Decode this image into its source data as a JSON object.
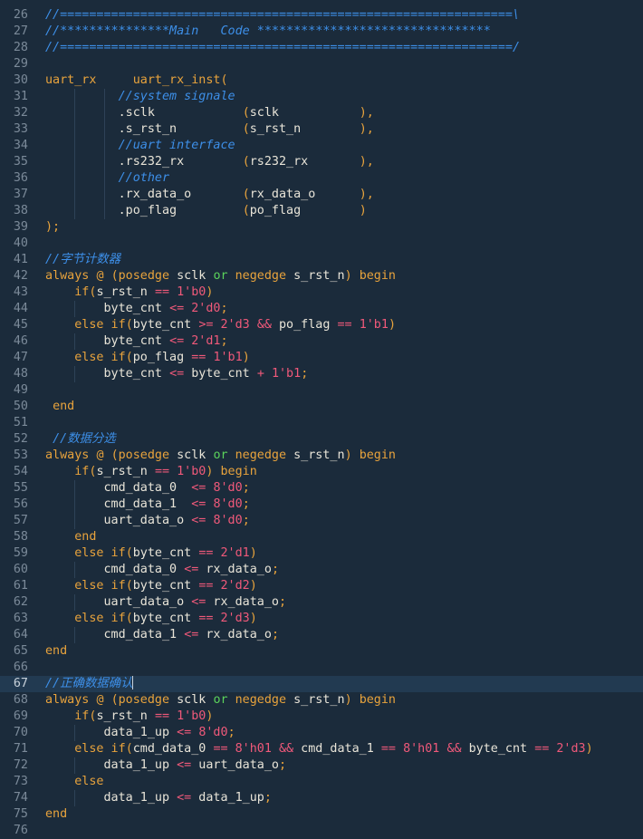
{
  "editor": {
    "active_line": 67,
    "lines": [
      {
        "n": 26,
        "tokens": [
          [
            "comment",
            "//==============================================================\\"
          ]
        ]
      },
      {
        "n": 27,
        "tokens": [
          [
            "comment",
            "//***************Main   Code ********************************"
          ]
        ]
      },
      {
        "n": 28,
        "tokens": [
          [
            "comment",
            "//==============================================================/"
          ]
        ]
      },
      {
        "n": 29,
        "tokens": []
      },
      {
        "n": 30,
        "tokens": [
          [
            "kw",
            "uart_rx"
          ],
          [
            "plain",
            "     "
          ],
          [
            "kw",
            "uart_rx_inst("
          ]
        ]
      },
      {
        "n": 31,
        "tokens": [
          [
            "plain",
            "          "
          ],
          [
            "comment",
            "//system signale"
          ]
        ]
      },
      {
        "n": 32,
        "tokens": [
          [
            "plain",
            "          "
          ],
          [
            "plain",
            ".sclk"
          ],
          [
            "plain",
            "            "
          ],
          [
            "punct",
            "("
          ],
          [
            "plain",
            "sclk"
          ],
          [
            "plain",
            "           "
          ],
          [
            "punct",
            "),"
          ]
        ]
      },
      {
        "n": 33,
        "tokens": [
          [
            "plain",
            "          "
          ],
          [
            "plain",
            ".s_rst_n"
          ],
          [
            "plain",
            "         "
          ],
          [
            "punct",
            "("
          ],
          [
            "plain",
            "s_rst_n"
          ],
          [
            "plain",
            "        "
          ],
          [
            "punct",
            "),"
          ]
        ]
      },
      {
        "n": 34,
        "tokens": [
          [
            "plain",
            "          "
          ],
          [
            "comment",
            "//uart interface"
          ]
        ]
      },
      {
        "n": 35,
        "tokens": [
          [
            "plain",
            "          "
          ],
          [
            "plain",
            ".rs232_rx"
          ],
          [
            "plain",
            "        "
          ],
          [
            "punct",
            "("
          ],
          [
            "plain",
            "rs232_rx"
          ],
          [
            "plain",
            "       "
          ],
          [
            "punct",
            "),"
          ]
        ]
      },
      {
        "n": 36,
        "tokens": [
          [
            "plain",
            "          "
          ],
          [
            "comment",
            "//other"
          ]
        ]
      },
      {
        "n": 37,
        "tokens": [
          [
            "plain",
            "          "
          ],
          [
            "plain",
            ".rx_data_o"
          ],
          [
            "plain",
            "       "
          ],
          [
            "punct",
            "("
          ],
          [
            "plain",
            "rx_data_o"
          ],
          [
            "plain",
            "      "
          ],
          [
            "punct",
            "),"
          ]
        ]
      },
      {
        "n": 38,
        "tokens": [
          [
            "plain",
            "          "
          ],
          [
            "plain",
            ".po_flag"
          ],
          [
            "plain",
            "         "
          ],
          [
            "punct",
            "("
          ],
          [
            "plain",
            "po_flag"
          ],
          [
            "plain",
            "        "
          ],
          [
            "punct",
            ")"
          ]
        ]
      },
      {
        "n": 39,
        "tokens": [
          [
            "punct",
            ");"
          ]
        ]
      },
      {
        "n": 40,
        "tokens": []
      },
      {
        "n": 41,
        "tokens": [
          [
            "comment",
            "//"
          ],
          [
            "cjk",
            "字节计数器"
          ]
        ]
      },
      {
        "n": 42,
        "tokens": [
          [
            "kw",
            "always"
          ],
          [
            "plain",
            " "
          ],
          [
            "kw",
            "@"
          ],
          [
            "plain",
            " "
          ],
          [
            "punct",
            "("
          ],
          [
            "kw",
            "posedge"
          ],
          [
            "plain",
            " sclk "
          ],
          [
            "green",
            "or"
          ],
          [
            "plain",
            " "
          ],
          [
            "kw",
            "negedge"
          ],
          [
            "plain",
            " s_rst_n"
          ],
          [
            "punct",
            ")"
          ],
          [
            "plain",
            " "
          ],
          [
            "kw",
            "begin"
          ]
        ]
      },
      {
        "n": 43,
        "tokens": [
          [
            "plain",
            "    "
          ],
          [
            "kw",
            "if"
          ],
          [
            "punct",
            "("
          ],
          [
            "plain",
            "s_rst_n "
          ],
          [
            "op",
            "=="
          ],
          [
            "plain",
            " "
          ],
          [
            "num",
            "1'b0"
          ],
          [
            "punct",
            ")"
          ]
        ]
      },
      {
        "n": 44,
        "tokens": [
          [
            "plain",
            "        byte_cnt "
          ],
          [
            "op",
            "<="
          ],
          [
            "plain",
            " "
          ],
          [
            "num",
            "2'd0"
          ],
          [
            "punct",
            ";"
          ]
        ]
      },
      {
        "n": 45,
        "tokens": [
          [
            "plain",
            "    "
          ],
          [
            "kw",
            "else if"
          ],
          [
            "punct",
            "("
          ],
          [
            "plain",
            "byte_cnt "
          ],
          [
            "op",
            ">="
          ],
          [
            "plain",
            " "
          ],
          [
            "num",
            "2'd3"
          ],
          [
            "plain",
            " "
          ],
          [
            "op",
            "&&"
          ],
          [
            "plain",
            " po_flag "
          ],
          [
            "op",
            "=="
          ],
          [
            "plain",
            " "
          ],
          [
            "num",
            "1'b1"
          ],
          [
            "punct",
            ")"
          ]
        ]
      },
      {
        "n": 46,
        "tokens": [
          [
            "plain",
            "        byte_cnt "
          ],
          [
            "op",
            "<="
          ],
          [
            "plain",
            " "
          ],
          [
            "num",
            "2'd1"
          ],
          [
            "punct",
            ";"
          ]
        ]
      },
      {
        "n": 47,
        "tokens": [
          [
            "plain",
            "    "
          ],
          [
            "kw",
            "else if"
          ],
          [
            "punct",
            "("
          ],
          [
            "plain",
            "po_flag "
          ],
          [
            "op",
            "=="
          ],
          [
            "plain",
            " "
          ],
          [
            "num",
            "1'b1"
          ],
          [
            "punct",
            ")"
          ]
        ]
      },
      {
        "n": 48,
        "tokens": [
          [
            "plain",
            "        byte_cnt "
          ],
          [
            "op",
            "<="
          ],
          [
            "plain",
            " byte_cnt "
          ],
          [
            "op",
            "+"
          ],
          [
            "plain",
            " "
          ],
          [
            "num",
            "1'b1"
          ],
          [
            "punct",
            ";"
          ]
        ]
      },
      {
        "n": 49,
        "tokens": []
      },
      {
        "n": 50,
        "tokens": [
          [
            "plain",
            " "
          ],
          [
            "kw",
            "end"
          ]
        ]
      },
      {
        "n": 51,
        "tokens": []
      },
      {
        "n": 52,
        "tokens": [
          [
            "plain",
            " "
          ],
          [
            "comment",
            "//"
          ],
          [
            "cjk",
            "数据分选"
          ]
        ]
      },
      {
        "n": 53,
        "tokens": [
          [
            "kw",
            "always"
          ],
          [
            "plain",
            " "
          ],
          [
            "kw",
            "@"
          ],
          [
            "plain",
            " "
          ],
          [
            "punct",
            "("
          ],
          [
            "kw",
            "posedge"
          ],
          [
            "plain",
            " sclk "
          ],
          [
            "green",
            "or"
          ],
          [
            "plain",
            " "
          ],
          [
            "kw",
            "negedge"
          ],
          [
            "plain",
            " s_rst_n"
          ],
          [
            "punct",
            ")"
          ],
          [
            "plain",
            " "
          ],
          [
            "kw",
            "begin"
          ]
        ]
      },
      {
        "n": 54,
        "tokens": [
          [
            "plain",
            "    "
          ],
          [
            "kw",
            "if"
          ],
          [
            "punct",
            "("
          ],
          [
            "plain",
            "s_rst_n "
          ],
          [
            "op",
            "=="
          ],
          [
            "plain",
            " "
          ],
          [
            "num",
            "1'b0"
          ],
          [
            "punct",
            ")"
          ],
          [
            "plain",
            " "
          ],
          [
            "kw",
            "begin"
          ]
        ]
      },
      {
        "n": 55,
        "tokens": [
          [
            "plain",
            "        cmd_data_0  "
          ],
          [
            "op",
            "<="
          ],
          [
            "plain",
            " "
          ],
          [
            "num",
            "8'd0"
          ],
          [
            "punct",
            ";"
          ]
        ]
      },
      {
        "n": 56,
        "tokens": [
          [
            "plain",
            "        cmd_data_1  "
          ],
          [
            "op",
            "<="
          ],
          [
            "plain",
            " "
          ],
          [
            "num",
            "8'd0"
          ],
          [
            "punct",
            ";"
          ]
        ]
      },
      {
        "n": 57,
        "tokens": [
          [
            "plain",
            "        uart_data_o "
          ],
          [
            "op",
            "<="
          ],
          [
            "plain",
            " "
          ],
          [
            "num",
            "8'd0"
          ],
          [
            "punct",
            ";"
          ]
        ]
      },
      {
        "n": 58,
        "tokens": [
          [
            "plain",
            "    "
          ],
          [
            "kw",
            "end"
          ]
        ]
      },
      {
        "n": 59,
        "tokens": [
          [
            "plain",
            "    "
          ],
          [
            "kw",
            "else if"
          ],
          [
            "punct",
            "("
          ],
          [
            "plain",
            "byte_cnt "
          ],
          [
            "op",
            "=="
          ],
          [
            "plain",
            " "
          ],
          [
            "num",
            "2'd1"
          ],
          [
            "punct",
            ")"
          ]
        ]
      },
      {
        "n": 60,
        "tokens": [
          [
            "plain",
            "        cmd_data_0 "
          ],
          [
            "op",
            "<="
          ],
          [
            "plain",
            " rx_data_o"
          ],
          [
            "punct",
            ";"
          ]
        ]
      },
      {
        "n": 61,
        "tokens": [
          [
            "plain",
            "    "
          ],
          [
            "kw",
            "else if"
          ],
          [
            "punct",
            "("
          ],
          [
            "plain",
            "byte_cnt "
          ],
          [
            "op",
            "=="
          ],
          [
            "plain",
            " "
          ],
          [
            "num",
            "2'd2"
          ],
          [
            "punct",
            ")"
          ]
        ]
      },
      {
        "n": 62,
        "tokens": [
          [
            "plain",
            "        uart_data_o "
          ],
          [
            "op",
            "<="
          ],
          [
            "plain",
            " rx_data_o"
          ],
          [
            "punct",
            ";"
          ]
        ]
      },
      {
        "n": 63,
        "tokens": [
          [
            "plain",
            "    "
          ],
          [
            "kw",
            "else if"
          ],
          [
            "punct",
            "("
          ],
          [
            "plain",
            "byte_cnt "
          ],
          [
            "op",
            "=="
          ],
          [
            "plain",
            " "
          ],
          [
            "num",
            "2'd3"
          ],
          [
            "punct",
            ")"
          ]
        ]
      },
      {
        "n": 64,
        "tokens": [
          [
            "plain",
            "        cmd_data_1 "
          ],
          [
            "op",
            "<="
          ],
          [
            "plain",
            " rx_data_o"
          ],
          [
            "punct",
            ";"
          ]
        ]
      },
      {
        "n": 65,
        "tokens": [
          [
            "kw",
            "end"
          ]
        ]
      },
      {
        "n": 66,
        "tokens": []
      },
      {
        "n": 67,
        "tokens": [
          [
            "comment",
            "//"
          ],
          [
            "cjk",
            "正确数据确认"
          ],
          [
            "cursor",
            ""
          ]
        ]
      },
      {
        "n": 68,
        "tokens": [
          [
            "kw",
            "always"
          ],
          [
            "plain",
            " "
          ],
          [
            "kw",
            "@"
          ],
          [
            "plain",
            " "
          ],
          [
            "punct",
            "("
          ],
          [
            "kw",
            "posedge"
          ],
          [
            "plain",
            " sclk "
          ],
          [
            "green",
            "or"
          ],
          [
            "plain",
            " "
          ],
          [
            "kw",
            "negedge"
          ],
          [
            "plain",
            " s_rst_n"
          ],
          [
            "punct",
            ")"
          ],
          [
            "plain",
            " "
          ],
          [
            "kw",
            "begin"
          ]
        ]
      },
      {
        "n": 69,
        "tokens": [
          [
            "plain",
            "    "
          ],
          [
            "kw",
            "if"
          ],
          [
            "punct",
            "("
          ],
          [
            "plain",
            "s_rst_n "
          ],
          [
            "op",
            "=="
          ],
          [
            "plain",
            " "
          ],
          [
            "num",
            "1'b0"
          ],
          [
            "punct",
            ")"
          ]
        ]
      },
      {
        "n": 70,
        "tokens": [
          [
            "plain",
            "        data_1_up "
          ],
          [
            "op",
            "<="
          ],
          [
            "plain",
            " "
          ],
          [
            "num",
            "8'd0"
          ],
          [
            "punct",
            ";"
          ]
        ]
      },
      {
        "n": 71,
        "tokens": [
          [
            "plain",
            "    "
          ],
          [
            "kw",
            "else if"
          ],
          [
            "punct",
            "("
          ],
          [
            "plain",
            "cmd_data_0 "
          ],
          [
            "op",
            "=="
          ],
          [
            "plain",
            " "
          ],
          [
            "num",
            "8'h01"
          ],
          [
            "plain",
            " "
          ],
          [
            "op",
            "&&"
          ],
          [
            "plain",
            " cmd_data_1 "
          ],
          [
            "op",
            "=="
          ],
          [
            "plain",
            " "
          ],
          [
            "num",
            "8'h01"
          ],
          [
            "plain",
            " "
          ],
          [
            "op",
            "&&"
          ],
          [
            "plain",
            " byte_cnt "
          ],
          [
            "op",
            "=="
          ],
          [
            "plain",
            " "
          ],
          [
            "num",
            "2'd3"
          ],
          [
            "punct",
            ")"
          ]
        ]
      },
      {
        "n": 72,
        "tokens": [
          [
            "plain",
            "        data_1_up "
          ],
          [
            "op",
            "<="
          ],
          [
            "plain",
            " uart_data_o"
          ],
          [
            "punct",
            ";"
          ]
        ]
      },
      {
        "n": 73,
        "tokens": [
          [
            "plain",
            "    "
          ],
          [
            "kw",
            "else"
          ]
        ]
      },
      {
        "n": 74,
        "tokens": [
          [
            "plain",
            "        data_1_up "
          ],
          [
            "op",
            "<="
          ],
          [
            "plain",
            " data_1_up"
          ],
          [
            "punct",
            ";"
          ]
        ]
      },
      {
        "n": 75,
        "tokens": [
          [
            "kw",
            "end"
          ]
        ]
      },
      {
        "n": 76,
        "tokens": []
      }
    ]
  }
}
